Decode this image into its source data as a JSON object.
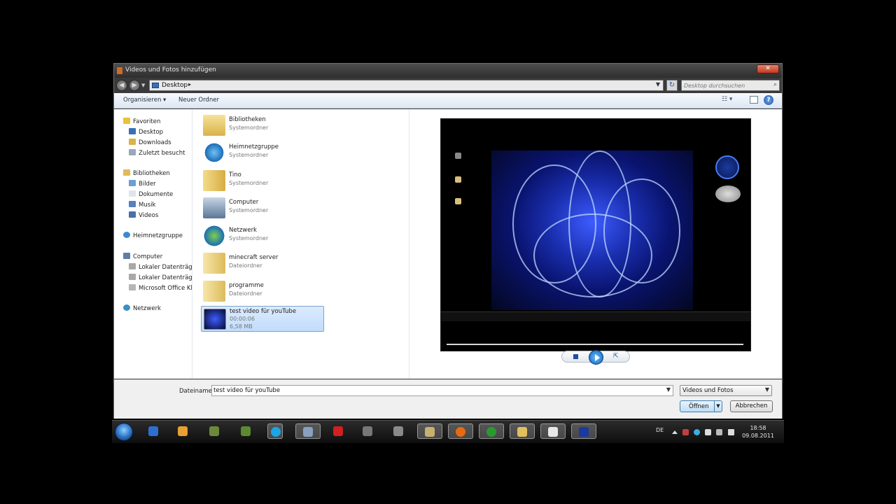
{
  "window": {
    "title": "Videos und Fotos hinzufügen"
  },
  "address": {
    "path": "Desktop",
    "search_placeholder": "Desktop durchsuchen"
  },
  "toolbar": {
    "organize": "Organisieren ▾",
    "new_folder": "Neuer Ordner"
  },
  "nav": {
    "favorites": "Favoriten",
    "favorites_items": [
      "Desktop",
      "Downloads",
      "Zuletzt besucht"
    ],
    "libraries": "Bibliotheken",
    "libraries_items": [
      "Bilder",
      "Dokumente",
      "Musik",
      "Videos"
    ],
    "homegroup": "Heimnetzgruppe",
    "computer": "Computer",
    "computer_items": [
      "Lokaler Datenträger",
      "Lokaler Datenträger",
      "Microsoft Office Klic"
    ],
    "network": "Netzwerk"
  },
  "files": [
    {
      "name": "Bibliotheken",
      "type": "Systemordner"
    },
    {
      "name": "Heimnetzgruppe",
      "type": "Systemordner"
    },
    {
      "name": "Tino",
      "type": "Systemordner"
    },
    {
      "name": "Computer",
      "type": "Systemordner"
    },
    {
      "name": "Netzwerk",
      "type": "Systemordner"
    },
    {
      "name": "minecraft server",
      "type": "Dateiordner"
    },
    {
      "name": "programme",
      "type": "Dateiordner"
    },
    {
      "name": "test video für youTube",
      "duration": "00:00:06",
      "size": "6,58 MB"
    }
  ],
  "bottom": {
    "filename_label": "Dateiname:",
    "filename_value": "test video für youTube",
    "filter": "Videos und Fotos",
    "open": "Öffnen",
    "cancel": "Abbrechen"
  },
  "taskbar": {
    "language": "DE",
    "time": "18:58",
    "date": "09.08.2011"
  },
  "colors": {
    "selection": "#c1dcfc",
    "toolbar": "#dde7f3",
    "taskbar": "#1a1a1a"
  }
}
